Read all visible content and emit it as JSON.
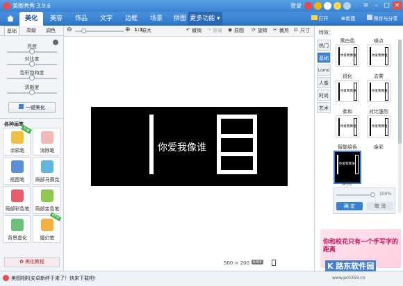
{
  "app": {
    "title": "美图秀秀 3.9.6",
    "login": "登录"
  },
  "menu": {
    "tabs": [
      "美化",
      "美容",
      "饰品",
      "文字",
      "边框",
      "场景",
      "拼图"
    ],
    "more": "更多功能",
    "open": "打开",
    "new": "新建",
    "save_share": "保存与分享"
  },
  "left": {
    "subtabs": [
      "基础",
      "高级",
      "调色"
    ],
    "sliders": [
      "亮度",
      "对比度",
      "色彩饱和度",
      "清晰度"
    ],
    "slider_levels": [
      0.5,
      0.5,
      0.5,
      0.5
    ],
    "auto_button": "一键美化",
    "brushes_title": "各种画笔",
    "tools": [
      {
        "label": "涂鸦笔",
        "badge": "升级"
      },
      {
        "label": "消除笔",
        "badge": ""
      },
      {
        "label": "抠图笔",
        "badge": ""
      },
      {
        "label": "局部马赛克",
        "badge": ""
      },
      {
        "label": "局部彩色笔",
        "badge": ""
      },
      {
        "label": "局部变色笔",
        "badge": ""
      },
      {
        "label": "背景虚化",
        "badge": ""
      },
      {
        "label": "魔幻笔",
        "badge": "NEW"
      }
    ],
    "tutorial": "美化教程"
  },
  "toolbar": {
    "ratio": "1:1",
    "original": "原大",
    "undo": "撤销",
    "redo": "重做",
    "original_image": "原图",
    "rotate": "旋转",
    "crop": "裁剪",
    "resize": "尺寸",
    "zoom_level": 0.15
  },
  "canvas": {
    "text": "你爱我像谁",
    "size": "500 × 200",
    "exif": "EXIF"
  },
  "right": {
    "title": "特效：",
    "tabs": [
      "热门",
      "基础",
      "Lomo",
      "人像",
      "时尚",
      "艺术"
    ],
    "effects": [
      "黑白色",
      "噪点",
      "锐化",
      "去雾",
      "柔和",
      "对比强烈",
      "智能绘色",
      "金彩",
      "反色"
    ],
    "thumb_text": "你爱我像谁",
    "opacity": "100%",
    "opacity_level": 1.0,
    "ok": "确 定",
    "cancel": "取 消",
    "ad_text": "你和校花只有一个手写字的距离"
  },
  "status": {
    "message": "美图相机安卓新终于来了！快来下载吧!",
    "watermark": "K 路东软件园",
    "watermark_url": "www.pc0359.cn"
  },
  "colors": {
    "accent": "#3a82d0",
    "title_bar": "#5aa2e6"
  }
}
